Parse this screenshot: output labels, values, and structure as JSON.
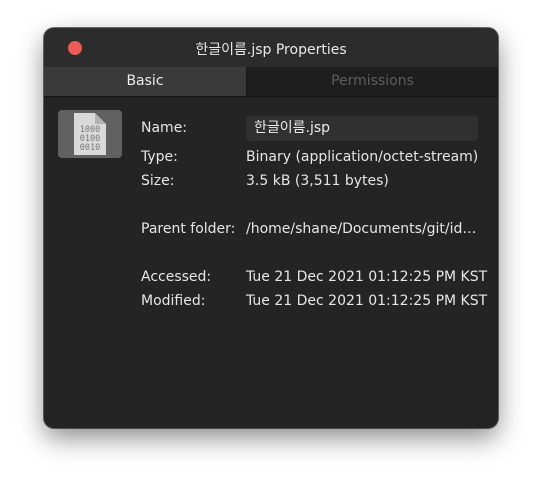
{
  "window": {
    "title": "한글이름.jsp Properties"
  },
  "tabs": [
    {
      "label": "Basic",
      "selected": true
    },
    {
      "label": "Permissions",
      "selected": false
    }
  ],
  "file_icon": {
    "icon": "binary-file-icon",
    "digits": [
      "1000",
      "0100",
      "0010"
    ]
  },
  "properties": {
    "name_label": "Name:",
    "name_value": "한글이름.jsp",
    "type_label": "Type:",
    "type_value": "Binary (application/octet-stream)",
    "size_label": "Size:",
    "size_value": "3.5 kB (3,511 bytes)",
    "parent_label": "Parent folder:",
    "parent_value": "/home/shane/Documents/git/id…",
    "accessed_label": "Accessed:",
    "accessed_value": "Tue 21 Dec 2021 01:12:25 PM KST",
    "modified_label": "Modified:",
    "modified_value": "Tue 21 Dec 2021 01:12:25 PM KST"
  },
  "colors": {
    "close_button": "#ec5b56",
    "window_background": "#242424",
    "selected_tab": "#3a3a3a"
  }
}
